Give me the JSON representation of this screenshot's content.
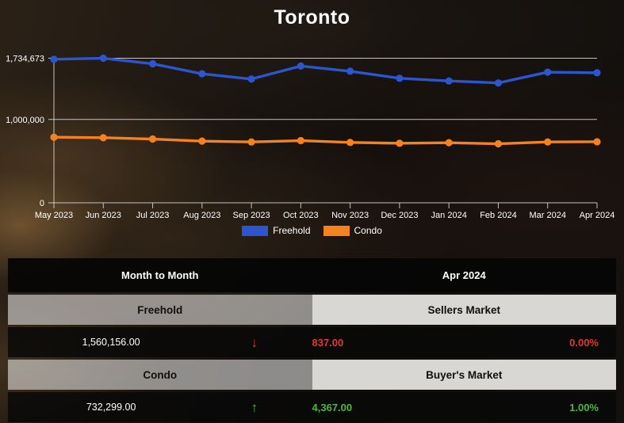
{
  "title": "Toronto",
  "chart_data": {
    "type": "line",
    "title": "Toronto",
    "x": [
      "May 2023",
      "Jun 2023",
      "Jul 2023",
      "Aug 2023",
      "Sep 2023",
      "Oct 2023",
      "Nov 2023",
      "Dec 2023",
      "Jan 2024",
      "Feb 2024",
      "Mar 2024",
      "Apr 2024"
    ],
    "series": [
      {
        "name": "Freehold",
        "color": "#2c55cf",
        "values": [
          1722000,
          1734673,
          1668000,
          1548000,
          1485000,
          1641000,
          1579000,
          1494000,
          1462000,
          1438000,
          1568000,
          1560156
        ]
      },
      {
        "name": "Condo",
        "color": "#f5821f",
        "values": [
          787000,
          781000,
          765000,
          740000,
          730000,
          746000,
          724000,
          714000,
          721000,
          708000,
          730000,
          732299
        ]
      }
    ],
    "yticks": [
      {
        "value": 1734673,
        "label": "1,734,673"
      },
      {
        "value": 1000000,
        "label": "1,000,000"
      },
      {
        "value": 0,
        "label": "0"
      }
    ],
    "ylim": [
      0,
      1806000
    ],
    "grid": true,
    "legend_position": "bottom",
    "axis_color": "#d8d5d0",
    "text_color": "#ffffff"
  },
  "table": {
    "col_left_header": "Month to Month",
    "col_right_header": "Apr 2024",
    "rows": [
      {
        "category": "Freehold",
        "market_status": "Sellers Market",
        "value": "1,560,156.00",
        "trend": "down",
        "trend_icon": "↓",
        "count": "837.00",
        "percent": "0.00%",
        "trend_color": "#dd3a30"
      },
      {
        "category": "Condo",
        "market_status": "Buyer's Market",
        "value": "732,299.00",
        "trend": "up",
        "trend_icon": "↑",
        "count": "4,367.00",
        "percent": "1.00%",
        "trend_color": "#4db83e"
      }
    ]
  }
}
